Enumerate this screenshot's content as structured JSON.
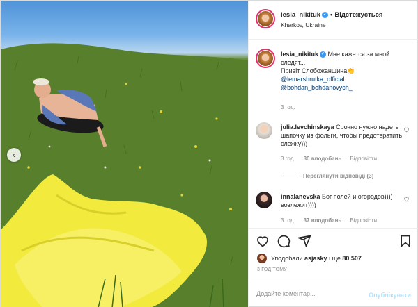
{
  "post": {
    "author": "lesia_nikituk",
    "follow_label": "Відстежується",
    "location": "Kharkov, Ukraine"
  },
  "caption": {
    "username": "lesia_nikituk",
    "text": "Мне кажется за мной следят...",
    "line2": "Привіт Слобожанщина👏",
    "mention1": "@lemarshrutka_official",
    "mention2": "@bohdan_bohdanovych_",
    "time": "3 год."
  },
  "comments": [
    {
      "username": "julia.levchinskaya",
      "text": "Срочно нужно надеть шапочку из фольги, чтобы предотвратить слежку)))",
      "time": "3 год.",
      "likes": "30 вподобань",
      "reply": "Відповісти",
      "view_replies": "Переглянути відповіді (3)"
    },
    {
      "username": "innalanevska",
      "text": "Бог полей и огородов)))) возлежит))))",
      "time": "3 год.",
      "likes": "37 вподобань",
      "reply": "Відповісти"
    }
  ],
  "likes": {
    "prefix": "Уподобали",
    "user": "asjasky",
    "middle": "і ще",
    "count": "80 507"
  },
  "timestamp": "3 ГОД ТОМУ",
  "composer": {
    "placeholder": "Додайте коментар...",
    "publish": "Опублікувати"
  },
  "colors": {
    "verified": "#3897f0",
    "link": "#00376b",
    "muted": "#8e8e8e",
    "publish_disabled": "#b2dffc",
    "story_ring": "#e1306c"
  },
  "icons": [
    "chevron-left-icon",
    "verified-badge-icon",
    "heart-icon",
    "comment-icon",
    "share-icon",
    "bookmark-icon"
  ]
}
